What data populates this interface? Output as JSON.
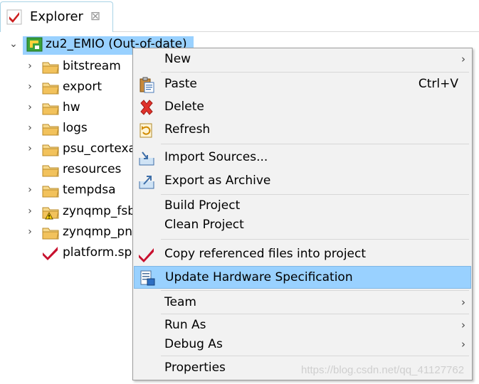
{
  "view": {
    "title": "Explorer",
    "close_glyph": "⊠"
  },
  "tree": {
    "root": {
      "label": "zu2_EMIO (Out-of-date)",
      "icon": "project-icon"
    },
    "items": [
      {
        "label": "bitstream",
        "icon": "folder-icon",
        "expandable": true
      },
      {
        "label": "export",
        "icon": "folder-icon",
        "expandable": true
      },
      {
        "label": "hw",
        "icon": "folder-icon",
        "expandable": true
      },
      {
        "label": "logs",
        "icon": "folder-icon",
        "expandable": true
      },
      {
        "label": "psu_cortexa",
        "icon": "folder-icon",
        "expandable": true
      },
      {
        "label": "resources",
        "icon": "folder-icon",
        "expandable": false
      },
      {
        "label": "tempdsa",
        "icon": "folder-icon",
        "expandable": true
      },
      {
        "label": "zynqmp_fsb",
        "icon": "folder-warning-icon",
        "expandable": true
      },
      {
        "label": "zynqmp_pn",
        "icon": "folder-icon",
        "expandable": true
      },
      {
        "label": "platform.sp",
        "icon": "xilinx-spec-icon",
        "expandable": false
      }
    ]
  },
  "context_menu": {
    "items": [
      {
        "label": "New",
        "submenu": true
      },
      {
        "label": "Paste",
        "accel": "Ctrl+V",
        "icon": "paste-icon"
      },
      {
        "label": "Delete",
        "icon": "delete-icon"
      },
      {
        "label": "Refresh",
        "icon": "refresh-icon"
      },
      {
        "label": "Import Sources...",
        "icon": "import-icon"
      },
      {
        "label": "Export as Archive",
        "icon": "export-icon"
      },
      {
        "label": "Build Project"
      },
      {
        "label": "Clean Project"
      },
      {
        "label": "Copy referenced files into project",
        "icon": "xilinx-icon"
      },
      {
        "label": "Update Hardware Specification",
        "icon": "hardware-spec-icon",
        "highlighted": true
      },
      {
        "label": "Team",
        "submenu": true
      },
      {
        "label": "Run As",
        "submenu": true
      },
      {
        "label": "Debug As",
        "submenu": true
      },
      {
        "label": "Properties"
      }
    ],
    "submenu_glyph": "›"
  },
  "colors": {
    "selection": "#99d1ff",
    "menu_bg": "#f2f2f2",
    "folder": "#f2c25c"
  },
  "watermark": "https://blog.csdn.net/qq_41127762"
}
